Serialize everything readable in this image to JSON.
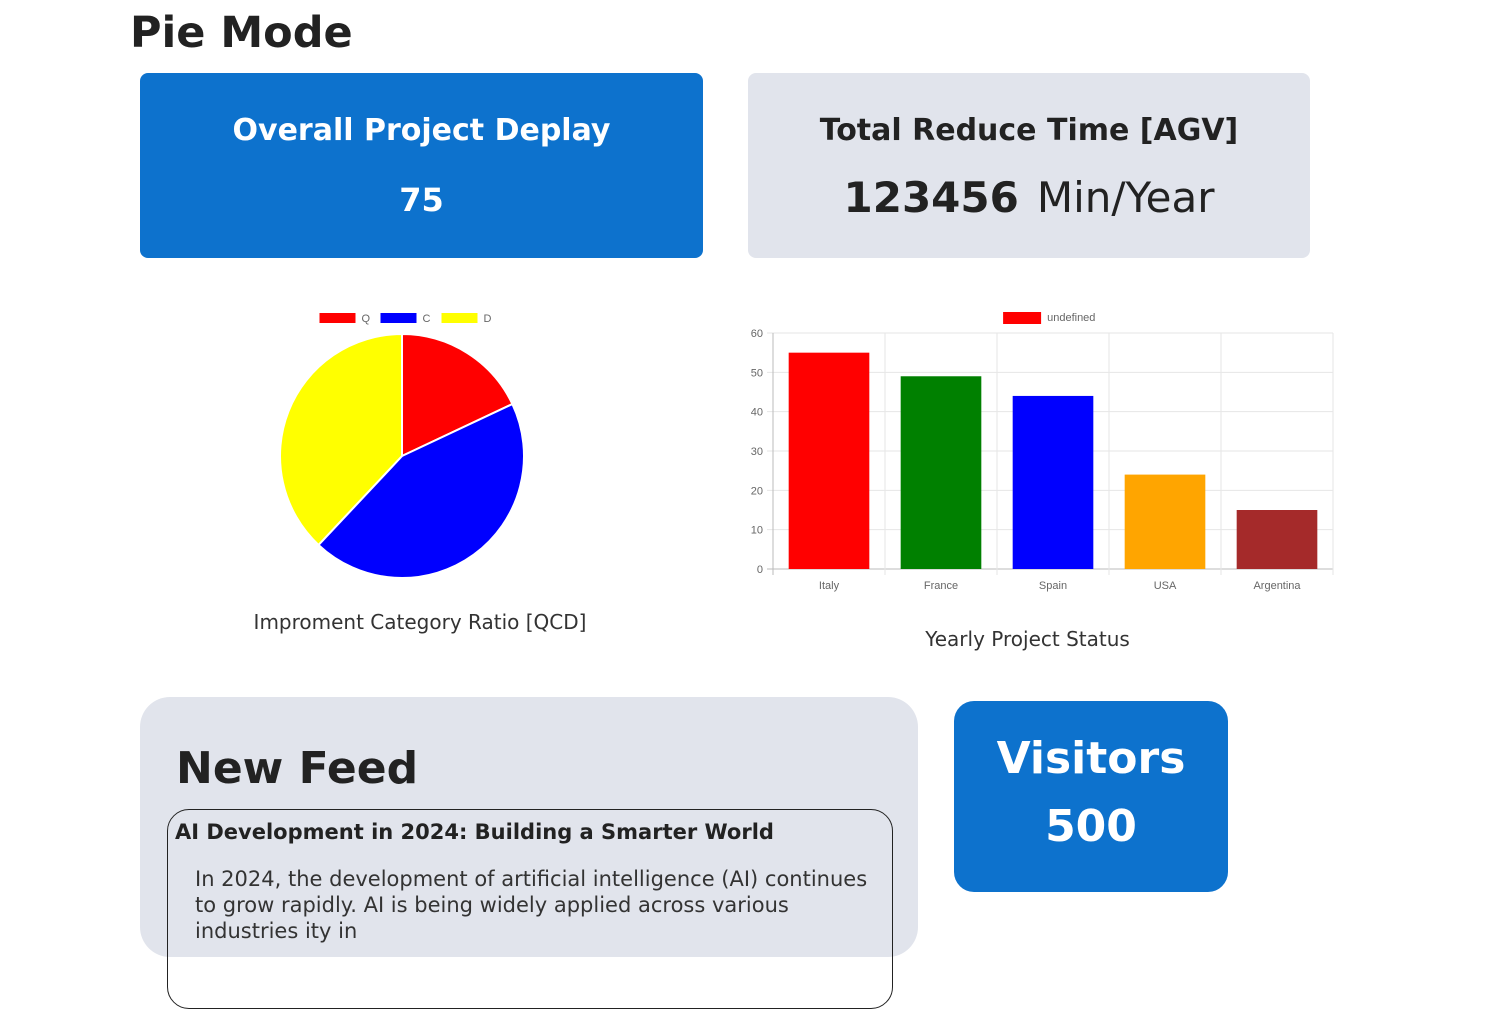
{
  "page": {
    "title": "Pie Mode"
  },
  "cards": {
    "deploy": {
      "title": "Overall Project Deplay",
      "value": "75"
    },
    "reduce": {
      "title": "Total Reduce Time [AGV]",
      "value": "123456",
      "unit": "Min/Year"
    },
    "visitors": {
      "title": "Visitors",
      "value": "500"
    }
  },
  "colors": {
    "accent_blue": "#0d72cd",
    "card_grey": "#e1e4ec"
  },
  "charts": {
    "pie_caption": "Improment Category Ratio [QCD]",
    "bar_caption": "Yearly Project Status"
  },
  "chart_data": [
    {
      "type": "pie",
      "labels": [
        "Q",
        "C",
        "D"
      ],
      "values": [
        18,
        44,
        38
      ],
      "colors": [
        "#ff0000",
        "#0000ff",
        "#ffff00"
      ],
      "legend": "top"
    },
    {
      "type": "bar",
      "categories": [
        "Italy",
        "France",
        "Spain",
        "USA",
        "Argentina"
      ],
      "values": [
        55,
        49,
        44,
        24,
        15
      ],
      "colors": [
        "#ff0000",
        "#008000",
        "#0000ff",
        "#ffa500",
        "#a52a2a"
      ],
      "legend_label": "undefined",
      "legend_color": "#ff0000",
      "ylim": [
        0,
        60
      ],
      "yticks": [
        0,
        10,
        20,
        30,
        40,
        50,
        60
      ],
      "grid": true,
      "legend": "top"
    }
  ],
  "feed": {
    "title": "New Feed",
    "article": {
      "title": "AI Development in 2024: Building a Smarter World",
      "body": "In 2024, the development of artificial intelligence (AI) continues to grow rapidly. AI is being widely applied across various industries ity in"
    }
  }
}
